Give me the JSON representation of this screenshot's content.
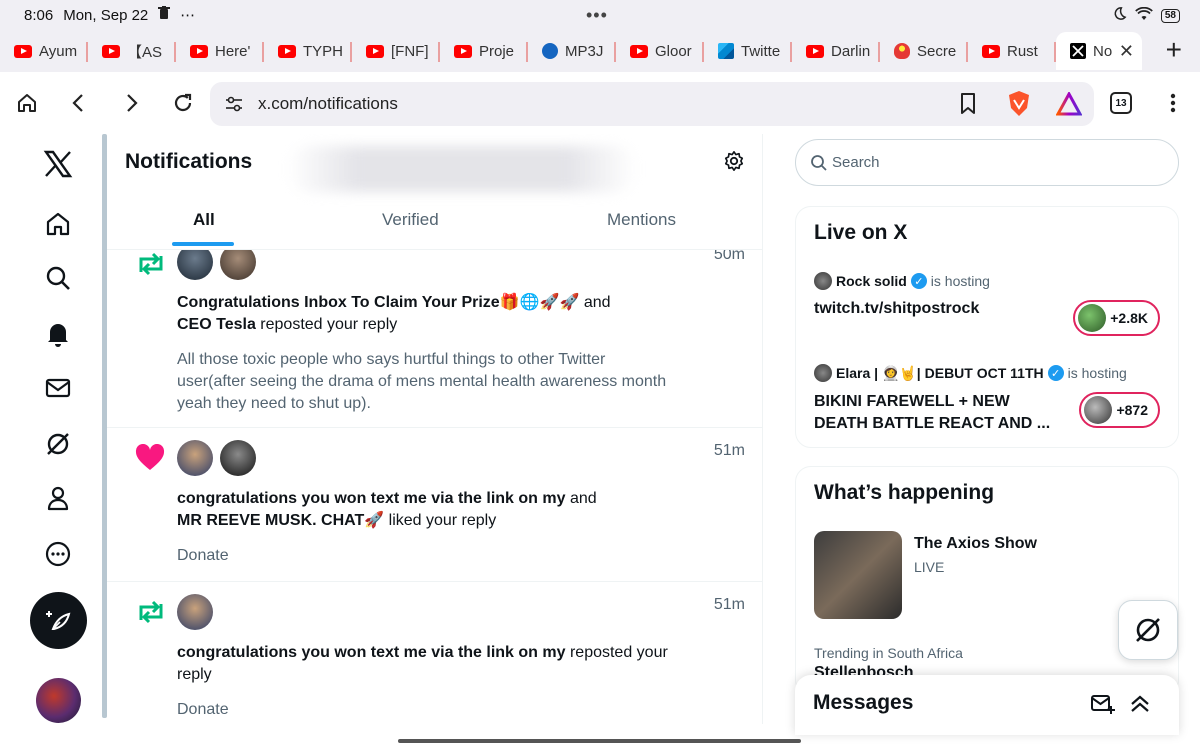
{
  "status_bar": {
    "time": "8:06",
    "date": "Mon, Sep 22",
    "dots": "•••",
    "battery": "58"
  },
  "tabs": [
    {
      "label": "Ayum",
      "favicon": "youtube-icon"
    },
    {
      "label": "【AS",
      "favicon": "youtube-icon"
    },
    {
      "label": "Here'",
      "favicon": "youtube-icon"
    },
    {
      "label": "TYPH",
      "favicon": "youtube-icon"
    },
    {
      "label": "[FNF]",
      "favicon": "youtube-icon"
    },
    {
      "label": "Proje",
      "favicon": "youtube-icon"
    },
    {
      "label": "MP3J",
      "favicon": "mp3-icon"
    },
    {
      "label": "Gloor",
      "favicon": "youtube-icon"
    },
    {
      "label": "Twitte",
      "favicon": "layers-icon"
    },
    {
      "label": "Darlin",
      "favicon": "youtube-icon"
    },
    {
      "label": "Secre",
      "favicon": "mushroom-icon"
    },
    {
      "label": "Rust",
      "favicon": "youtube-icon"
    },
    {
      "label": "No",
      "favicon": "x-logo-icon",
      "active": true
    }
  ],
  "address_bar": {
    "url": "x.com/notifications",
    "tab_count": "13"
  },
  "main": {
    "title": "Notifications",
    "tabs": [
      {
        "label": "All",
        "active": true
      },
      {
        "label": "Verified"
      },
      {
        "label": "Mentions"
      }
    ],
    "notifications": [
      {
        "type": "repost",
        "time": "50m",
        "actor1": "Congratulations Inbox To Claim Your Prize🎁🌐🚀🚀",
        "joiner": " and",
        "actor2": "CEO Tesla",
        "action": " reposted your reply",
        "snippet": "All those toxic people who says hurtful things to other Twitter user(after seeing the drama of mens mental health awareness month yeah they need to shut up)."
      },
      {
        "type": "like",
        "time": "51m",
        "actor1": "congratulations you won text me via the link on my",
        "joiner": " and",
        "actor2": "MR REEVE MUSK. CHAT🚀",
        "action": " liked your reply",
        "snippet": "Donate"
      },
      {
        "type": "repost",
        "time": "51m",
        "actor1": "congratulations you won text me via the link on my",
        "action": " reposted your reply",
        "snippet": "Donate"
      }
    ]
  },
  "sidebar": {
    "search_placeholder": "Search",
    "live": {
      "title": "Live on X",
      "items": [
        {
          "host": "Rock solid",
          "hosting": "is hosting",
          "title1": "twitch.tv/shitpostrock",
          "title2": "",
          "viewers": "+2.8K"
        },
        {
          "host": "Elara | 👩‍🚀🤘| DEBUT OCT 11TH",
          "hosting": "is hosting",
          "title1": "BIKINI FAREWELL + NEW",
          "title2": "DEATH BATTLE REACT AND ...",
          "viewers": "+872"
        }
      ]
    },
    "happening": {
      "title": "What’s happening",
      "show_name": "The Axios Show",
      "show_status": "LIVE",
      "trend_context": "Trending in South Africa",
      "trend_name": "Stellenbosch"
    },
    "messages_title": "Messages"
  },
  "colors": {
    "accent": "#1d9bf0",
    "repost": "#00ba7c",
    "like": "#f91880",
    "live_ring": "#e0245e"
  }
}
